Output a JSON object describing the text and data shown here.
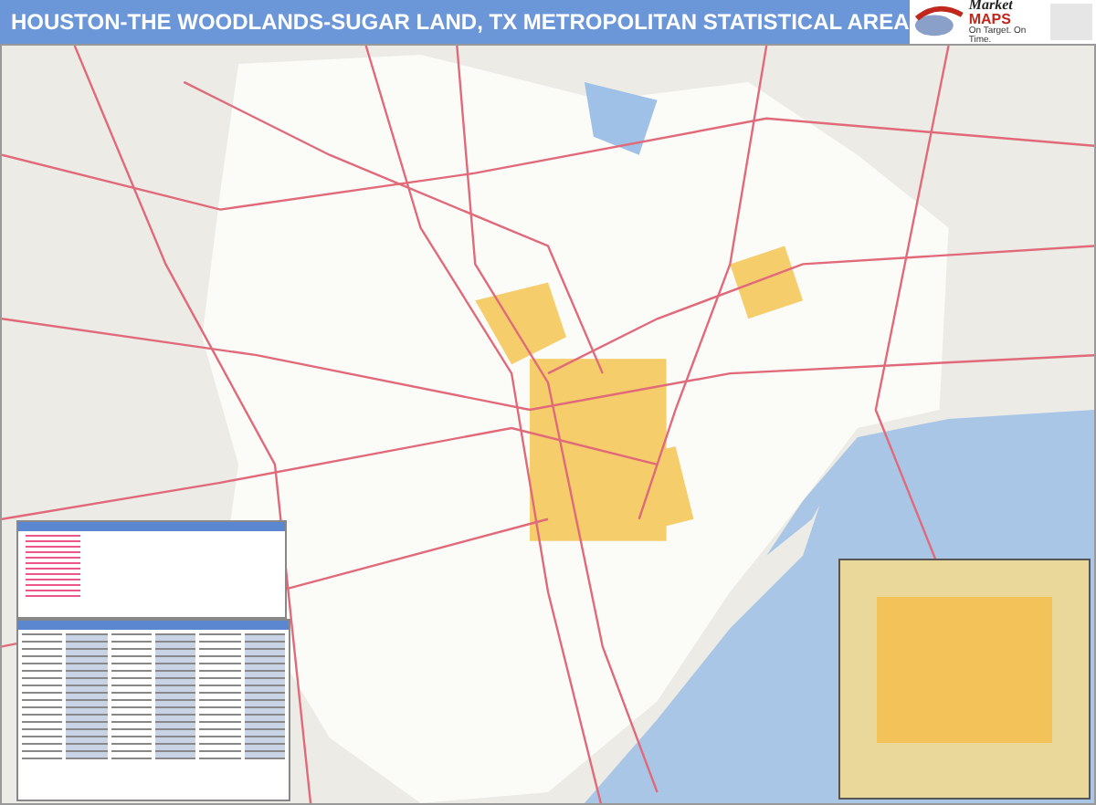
{
  "header": {
    "title": "HOUSTON-THE WOODLANDS-SUGAR LAND, TX METROPOLITAN STATISTICAL AREA"
  },
  "logo": {
    "name": "Market",
    "brand": "MAPS",
    "tagline": "On Target. On Time."
  }
}
